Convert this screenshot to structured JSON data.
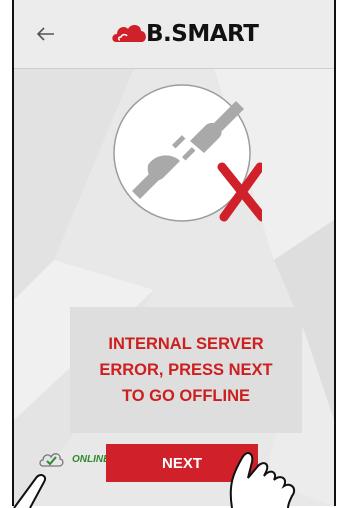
{
  "header": {
    "back_icon": "arrow-left-icon",
    "logo_text": "B.SMART",
    "logo_icon": "red-cloud-logo-icon"
  },
  "illustration": {
    "icon": "unplugged-connector-icon",
    "error_mark": "red-x-icon",
    "colors": {
      "plug": "#a9a9a9",
      "x": "#d0202a"
    }
  },
  "message": {
    "text": "INTERNAL SERVER ERROR, PRESS NEXT TO GO OFFLINE",
    "color": "#cc1f1f"
  },
  "footer": {
    "status_icon": "cloud-check-icon",
    "status_label": "ONLINE",
    "next_label": "NEXT",
    "accent": "#d0202a"
  }
}
